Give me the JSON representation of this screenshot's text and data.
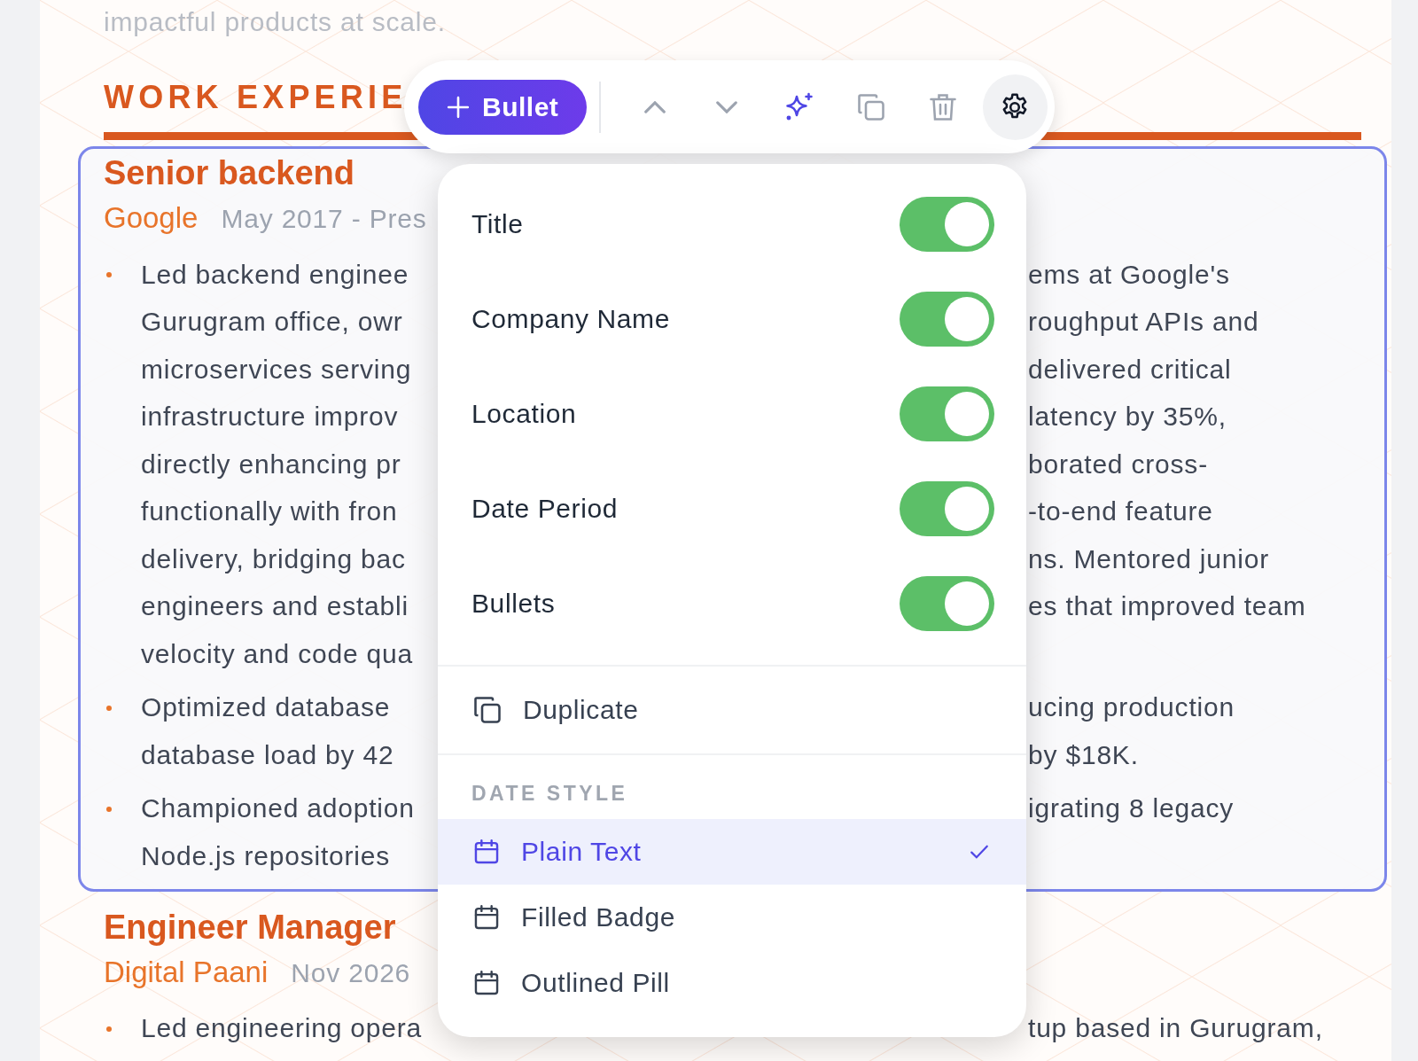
{
  "intro_tail": "impactful products at scale.",
  "section_title": "WORK EXPERIE",
  "toolbar": {
    "add_label": "Bullet",
    "settings_open": true
  },
  "settings_menu": {
    "toggles": [
      {
        "label": "Title",
        "on": true
      },
      {
        "label": "Company Name",
        "on": true
      },
      {
        "label": "Location",
        "on": true
      },
      {
        "label": "Date Period",
        "on": true
      },
      {
        "label": "Bullets",
        "on": true
      }
    ],
    "duplicate_label": "Duplicate",
    "date_style_heading": "DATE STYLE",
    "date_styles": [
      {
        "label": "Plain Text",
        "selected": true
      },
      {
        "label": "Filled Badge",
        "selected": false
      },
      {
        "label": "Outlined Pill",
        "selected": false
      }
    ]
  },
  "jobs": [
    {
      "selected": true,
      "title": "Senior backend",
      "company": "Google",
      "dates": "May 2017 - Pres",
      "bullets": [
        [
          {
            "left": "Led backend enginee",
            "right": "ems at Google's"
          },
          {
            "left": "Gurugram office, owr",
            "right": "roughput APIs and"
          },
          {
            "left": "microservices serving",
            "right": "delivered critical"
          },
          {
            "left": "infrastructure improv",
            "right": "latency by 35%,"
          },
          {
            "left": "directly enhancing pr",
            "right": "borated cross-"
          },
          {
            "left": "functionally with fron",
            "right": "-to-end feature"
          },
          {
            "left": "delivery, bridging bac",
            "right": "ns. Mentored junior"
          },
          {
            "left": "engineers and establi",
            "right": "es that improved team"
          },
          {
            "left": "velocity and code qua"
          }
        ],
        [
          {
            "left": "Optimized database",
            "right": "ucing production"
          },
          {
            "left": "database load by 42",
            "right": "by $18K."
          }
        ],
        [
          {
            "left": "Championed adoption",
            "right": "igrating 8 legacy"
          },
          {
            "left": "Node.js repositories"
          }
        ]
      ]
    },
    {
      "selected": false,
      "title": "Engineer Manager",
      "company": "Digital Paani",
      "dates": "Nov 2026",
      "bullets": [
        [
          {
            "left": "Led engineering opera",
            "right": "tup based in Gurugram,"
          }
        ]
      ]
    }
  ]
}
